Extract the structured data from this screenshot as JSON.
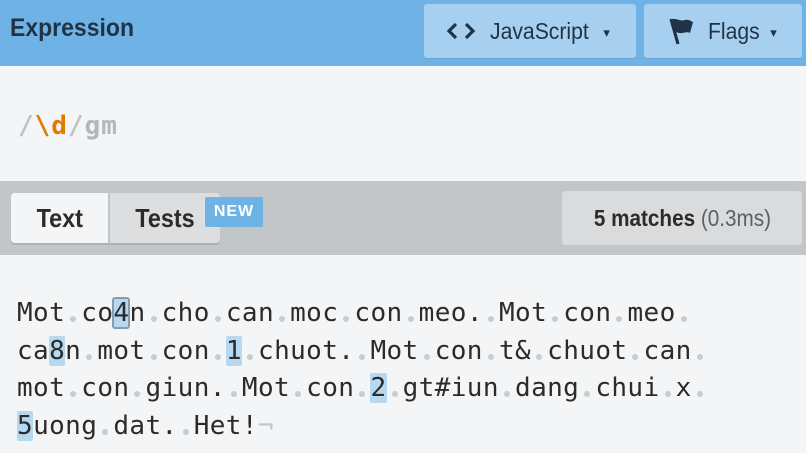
{
  "header": {
    "title": "Expression",
    "language_label": "JavaScript",
    "flags_label": "Flags",
    "caret": "▾"
  },
  "expression": {
    "open_delim": "/",
    "pattern": "\\d",
    "close_delim": "/",
    "flags": "gm"
  },
  "tabs": {
    "text_label": "Text",
    "tests_label": "Tests",
    "new_badge": "NEW"
  },
  "results": {
    "matches_label": "5 matches",
    "time_label": "(0.3ms)"
  },
  "text_lines": [
    [
      {
        "t": "Mot"
      },
      {
        "s": 1
      },
      {
        "t": "co"
      },
      {
        "m": "4",
        "sel": true
      },
      {
        "t": "n"
      },
      {
        "s": 1
      },
      {
        "t": "cho"
      },
      {
        "s": 1
      },
      {
        "t": "can"
      },
      {
        "s": 1
      },
      {
        "t": "moc"
      },
      {
        "s": 1
      },
      {
        "t": "con"
      },
      {
        "s": 1
      },
      {
        "t": "meo."
      },
      {
        "s": 1
      },
      {
        "t": "Mot"
      },
      {
        "s": 1
      },
      {
        "t": "con"
      },
      {
        "s": 1
      },
      {
        "t": "meo"
      },
      {
        "s": 1
      }
    ],
    [
      {
        "t": "ca"
      },
      {
        "m": "8"
      },
      {
        "t": "n"
      },
      {
        "s": 1
      },
      {
        "t": "mot"
      },
      {
        "s": 1
      },
      {
        "t": "con"
      },
      {
        "s": 1
      },
      {
        "m": "1"
      },
      {
        "s": 1
      },
      {
        "t": "chuot."
      },
      {
        "s": 1
      },
      {
        "t": "Mot"
      },
      {
        "s": 1
      },
      {
        "t": "con"
      },
      {
        "s": 1
      },
      {
        "t": "t&"
      },
      {
        "s": 1
      },
      {
        "t": "chuot"
      },
      {
        "s": 1
      },
      {
        "t": "can"
      },
      {
        "s": 1
      }
    ],
    [
      {
        "t": "mot"
      },
      {
        "s": 1
      },
      {
        "t": "con"
      },
      {
        "s": 1
      },
      {
        "t": "giun."
      },
      {
        "s": 1
      },
      {
        "t": "Mot"
      },
      {
        "s": 1
      },
      {
        "t": "con"
      },
      {
        "s": 1
      },
      {
        "m": "2"
      },
      {
        "s": 1
      },
      {
        "t": "gt#iun"
      },
      {
        "s": 1
      },
      {
        "t": "dang"
      },
      {
        "s": 1
      },
      {
        "t": "chui"
      },
      {
        "s": 1
      },
      {
        "t": "x"
      },
      {
        "s": 1
      }
    ],
    [
      {
        "m": "5"
      },
      {
        "t": "uong"
      },
      {
        "s": 1
      },
      {
        "t": "dat."
      },
      {
        "s": 1
      },
      {
        "t": "Het!"
      },
      {
        "e": "¬"
      }
    ]
  ],
  "colors": {
    "header_bg": "#6fb3e6",
    "button_bg": "#a7d0f0",
    "match_highlight": "#b7d8f1",
    "escape_orange": "#e07b00"
  },
  "icons": {
    "language": "code-brackets-icon",
    "flags": "flag-icon"
  }
}
